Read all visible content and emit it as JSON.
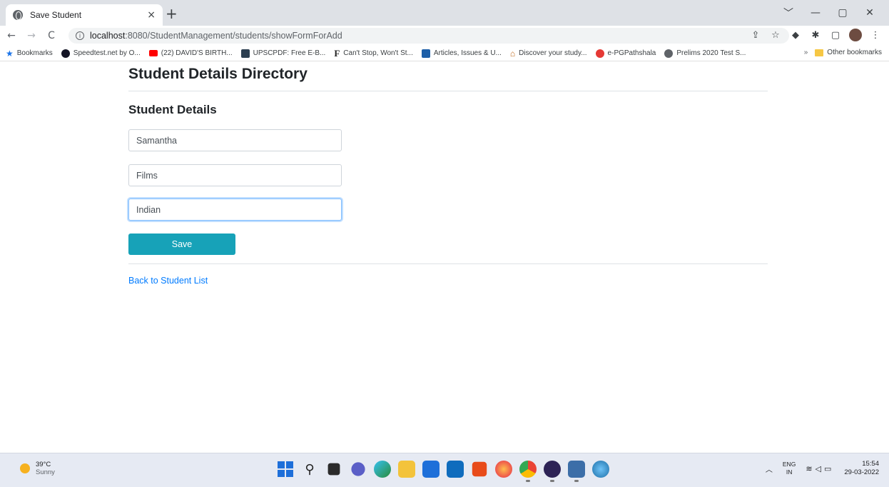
{
  "browser": {
    "tab_title": "Save Student",
    "tab_close": "×",
    "new_tab": "+",
    "window_controls": [
      "﹀",
      "—",
      "▢",
      "✕"
    ],
    "url_host": "localhost",
    "url_path": ":8080/StudentManagement/students/showFormForAdd"
  },
  "bookmarks": {
    "items": [
      {
        "label": "Bookmarks",
        "icon": "star-icon",
        "color": "#1a73e8"
      },
      {
        "label": "Speedtest.net by O...",
        "icon": "speedtest-icon",
        "color": "#141526"
      },
      {
        "label": "(22) DAVID'S BIRTH...",
        "icon": "youtube-icon",
        "color": "#ff0000"
      },
      {
        "label": "UPSCPDF: Free E-B...",
        "icon": "upscpdf-icon",
        "color": "#2c3e50"
      },
      {
        "label": "Can't Stop, Won't St...",
        "icon": "f-icon",
        "color": "#222222"
      },
      {
        "label": "Articles, Issues & U...",
        "icon": "articles-icon",
        "color": "#1d5fa8"
      },
      {
        "label": "Discover your study...",
        "icon": "discover-icon",
        "color": "#c2691b"
      },
      {
        "label": "e-PGPathshala",
        "icon": "epg-icon",
        "color": "#e53935"
      },
      {
        "label": "Prelims 2020 Test S...",
        "icon": "globe-icon",
        "color": "#5f6368"
      }
    ],
    "more": "»",
    "other": "Other bookmarks"
  },
  "page": {
    "title": "Student Details Directory",
    "section_title": "Student Details",
    "fields": [
      {
        "value": "Samantha"
      },
      {
        "value": "Films"
      },
      {
        "value": "Indian"
      }
    ],
    "save_label": "Save",
    "back_label": "Back to Student List",
    "colors": {
      "button": "#17a2b8",
      "link": "#007bff"
    }
  },
  "taskbar": {
    "weather_temp": "39°C",
    "weather_cond": "Sunny",
    "lang_top": "ENG",
    "lang_bottom": "IN",
    "time": "15:54",
    "date": "29-03-2022"
  }
}
